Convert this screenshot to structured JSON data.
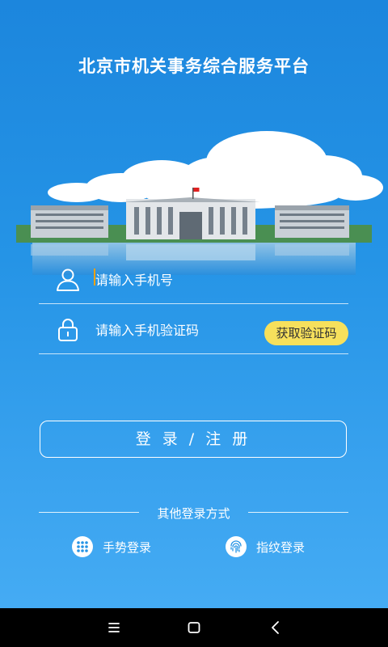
{
  "header": {
    "title": "北京市机关事务综合服务平台"
  },
  "phone_field": {
    "placeholder": "请输入手机号",
    "icon": "user-icon"
  },
  "code_field": {
    "placeholder": "请输入手机验证码",
    "icon": "lock-icon",
    "get_code_label": "获取验证码"
  },
  "login_button": {
    "label": "登 录 / 注 册"
  },
  "other_methods": {
    "title": "其他登录方式",
    "items": [
      {
        "label": "手势登录",
        "icon": "gesture-grid-icon"
      },
      {
        "label": "指纹登录",
        "icon": "fingerprint-icon"
      }
    ]
  },
  "colors": {
    "accent_yellow": "#f6e05c",
    "background_blue": "#2594e6"
  }
}
